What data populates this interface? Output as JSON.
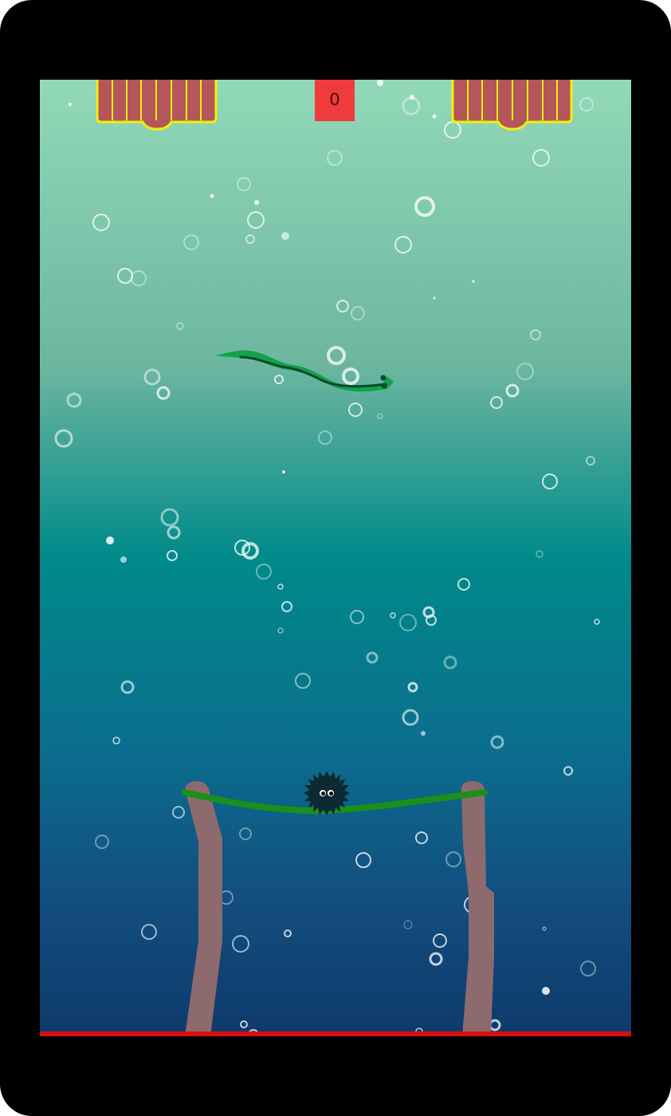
{
  "game": {
    "score": "0",
    "colors": {
      "water_top": "#92d9b8",
      "water_mid": "#008a8a",
      "water_bottom": "#0e3a6b",
      "score_box": "#ef3b3b",
      "floor_line": "#d90f0f",
      "crate_fill": "#b5565a",
      "crate_stroke": "#f0f00c",
      "eel": "#12a24a",
      "eel_stripe": "#0b4a2a",
      "seaweed_rope": "#1a8f1a",
      "post": "#8d6a6e",
      "urchin": "#0d2a33"
    }
  }
}
